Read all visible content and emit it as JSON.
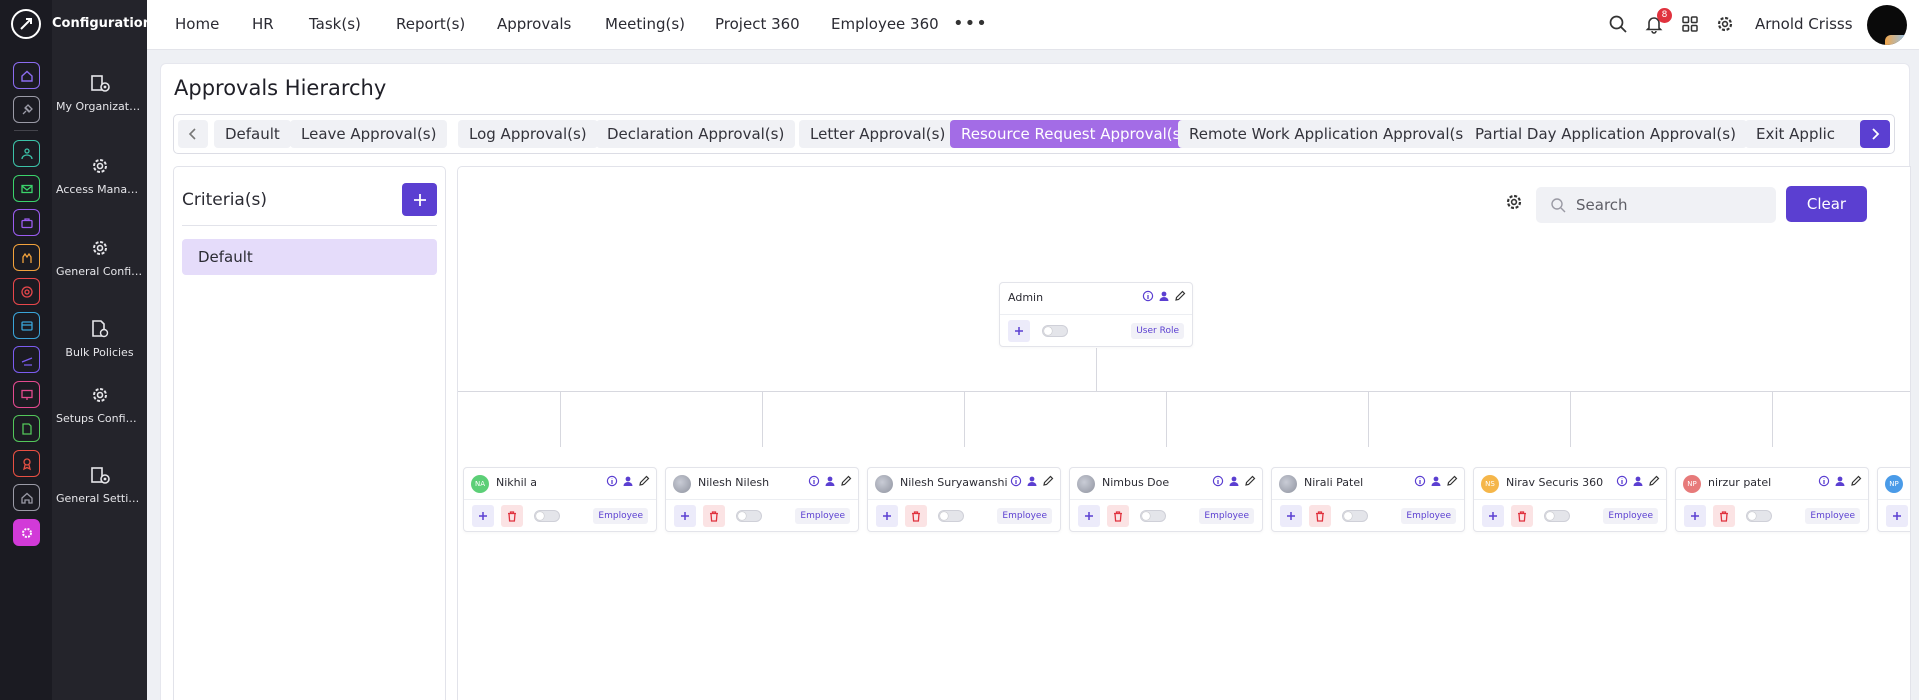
{
  "app": {
    "section_title": "Configuration"
  },
  "rail": {
    "items": [
      {
        "icon": "home-icon",
        "color": "#8b6cf0"
      },
      {
        "icon": "pin-icon",
        "color": "#9a9aa6"
      },
      {
        "icon": "team-icon",
        "color": "#3cc2a8"
      },
      {
        "icon": "mail-icon",
        "color": "#3bd36b"
      },
      {
        "icon": "briefcase-icon",
        "color": "#9b5cf0"
      },
      {
        "icon": "hands-icon",
        "color": "#f2a23c"
      },
      {
        "icon": "target-icon",
        "color": "#e8474b"
      },
      {
        "icon": "archive-icon",
        "color": "#3aa4d8"
      },
      {
        "icon": "plane-icon",
        "color": "#7b5cf0"
      },
      {
        "icon": "presentation-icon",
        "color": "#e44a8f"
      },
      {
        "icon": "document-icon",
        "color": "#53c65a"
      },
      {
        "icon": "award-icon",
        "color": "#e85043"
      },
      {
        "icon": "house-icon",
        "color": "#9a9aa6"
      },
      {
        "icon": "settings-icon",
        "color": "#d23ad8"
      }
    ]
  },
  "config_menu": {
    "items": [
      {
        "label": "My Organization",
        "icon": "gear-building-icon"
      },
      {
        "label": "Access Management",
        "icon": "gear-icon"
      },
      {
        "label": "General Configurati...",
        "icon": "gear-icon"
      },
      {
        "label": "Bulk Policies",
        "icon": "policy-document-icon"
      },
      {
        "label": "Setups Configurati...",
        "icon": "gear-icon"
      },
      {
        "label": "General Settings",
        "icon": "gear-building-icon"
      }
    ]
  },
  "topnav": {
    "items": [
      "Home",
      "HR",
      "Task(s)",
      "Report(s)",
      "Approvals",
      "Meeting(s)",
      "Project 360",
      "Employee 360"
    ],
    "more_label": "•••",
    "notification_count": "8",
    "user_name": "Arnold Crisss"
  },
  "page": {
    "title": "Approvals Hierarchy",
    "tabs": [
      "Default",
      "Leave Approval(s)",
      "Log Approval(s)",
      "Declaration Approval(s)",
      "Letter Approval(s)",
      "Resource Request Approval(s)",
      "Remote Work Application Approval(s)",
      "Partial Day Application Approval(s)",
      "Exit Applic"
    ],
    "active_tab": "Resource Request Approval(s)"
  },
  "criteria": {
    "title": "Criteria(s)",
    "items": [
      "Default"
    ]
  },
  "canvas": {
    "search_placeholder": "Search",
    "clear_label": "Clear"
  },
  "hierarchy": {
    "root": {
      "name": "Admin",
      "tag": "User Role"
    },
    "children": [
      {
        "name": "Nikhil a",
        "initials": "NA",
        "avatar_color": "#5ccf77",
        "tag": "Employee"
      },
      {
        "name": "Nilesh Nilesh",
        "initials": "",
        "avatar_color": "gray",
        "tag": "Employee"
      },
      {
        "name": "Nilesh Suryawanshi",
        "initials": "",
        "avatar_color": "gray",
        "tag": "Employee"
      },
      {
        "name": "Nimbus Doe",
        "initials": "",
        "avatar_color": "gray",
        "tag": "Employee"
      },
      {
        "name": "Nirali Patel",
        "initials": "",
        "avatar_color": "gray",
        "tag": "Employee"
      },
      {
        "name": "Nirav Securis 360",
        "initials": "NS",
        "avatar_color": "#f5b64a",
        "tag": "Employee"
      },
      {
        "name": "nirzur patel",
        "initials": "NP",
        "avatar_color": "#e77a7a",
        "tag": "Employee"
      },
      {
        "name": "",
        "initials": "NP",
        "avatar_color": "#4a9be8",
        "tag": ""
      }
    ]
  },
  "colors": {
    "accent": "#5b3fd1",
    "active_tab": "#a36ce6",
    "danger": "#e0323e"
  }
}
